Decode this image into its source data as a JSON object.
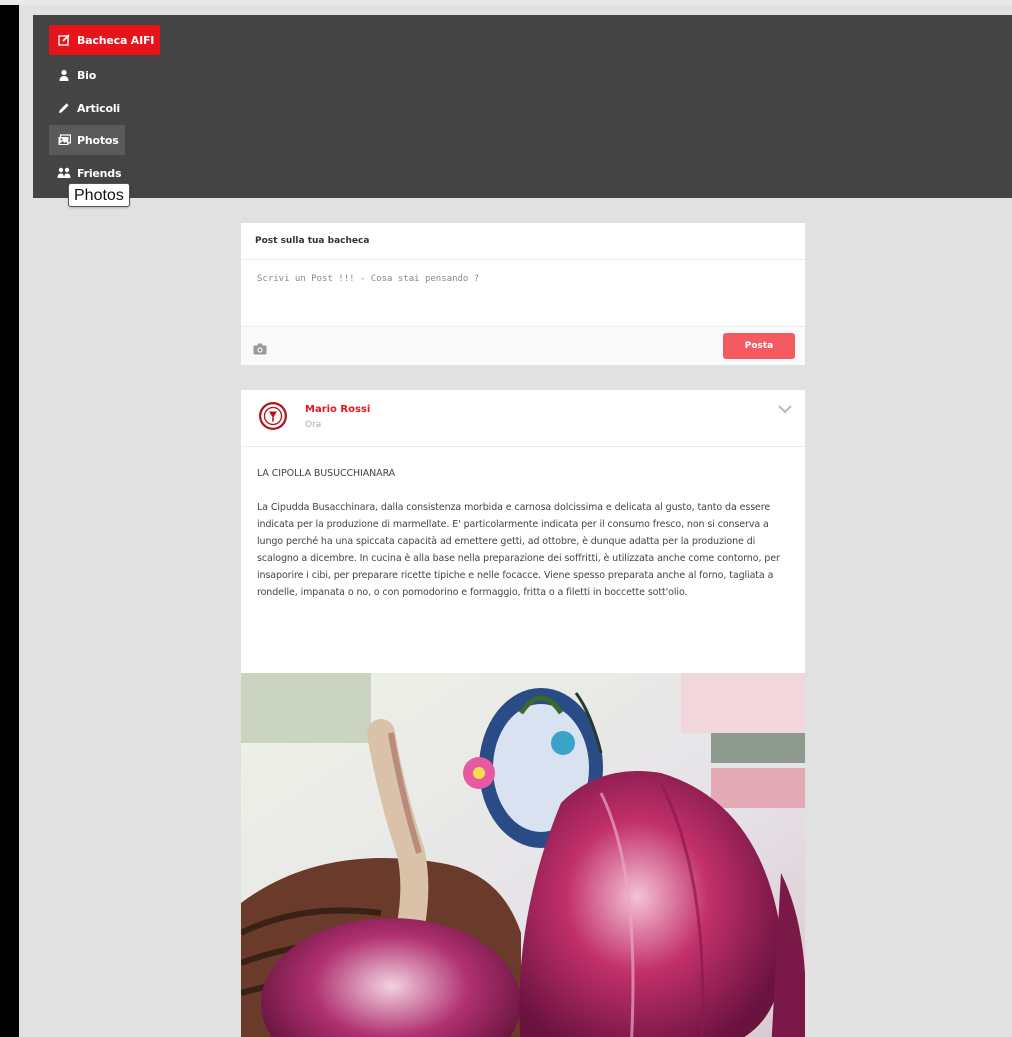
{
  "nav": {
    "items": [
      {
        "label": "Bacheca AIFI",
        "icon": "edit-icon",
        "state": "active"
      },
      {
        "label": "Bio",
        "icon": "user-icon",
        "state": "normal"
      },
      {
        "label": "Articoli",
        "icon": "pencil-icon",
        "state": "normal"
      },
      {
        "label": "Photos",
        "icon": "photos-icon",
        "state": "hover"
      },
      {
        "label": "Friends",
        "icon": "friends-icon",
        "state": "normal"
      }
    ],
    "tooltip": "Photos"
  },
  "compose": {
    "title": "Post sulla tua bacheca",
    "placeholder": "Scrivi un Post !!! - Cosa stai pensando ?",
    "submit_label": "Posta"
  },
  "post": {
    "author": "Mario Rossi",
    "time": "Ora",
    "title": "LA CIPOLLA BUSUCCHIANARA",
    "text": "La Cipudda Busacchinara, dalla consistenza morbida e carnosa dolcissima e delicata al gusto, tanto da essere indicata per la produzione di marmellate. E' particolarmente indicata per il consumo fresco, non si conserva a lungo perché ha una spiccata capacità ad emettere getti, ad ottobre, è dunque adatta per la produzione di scalogno a dicembre. In cucina è alla base nella preparazione dei soffritti, è utilizzata anche come contorno, per insaporire i cibi, per preparare ricette tipiche e nelle focacce. Viene spesso preparata anche al forno, tagliata a rondelle, impanata o no, o con pomodorino e formaggio, fritta o a filetti in boccette sott'olio."
  },
  "colors": {
    "accent": "#e8141b",
    "post_button": "#f45a62",
    "topbar": "#444444",
    "page_bg": "#e1e1e1"
  }
}
